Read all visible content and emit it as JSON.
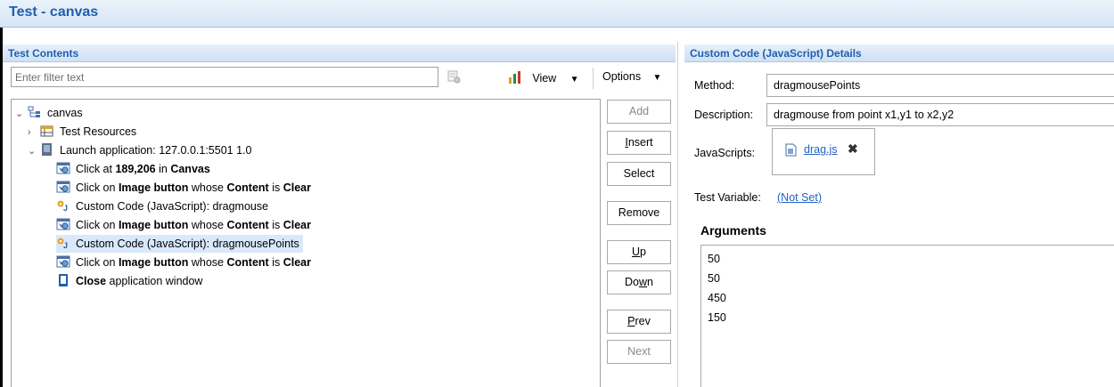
{
  "window": {
    "title": "Test - canvas"
  },
  "left_panel": {
    "header": "Test Contents",
    "filter_placeholder": "Enter filter text",
    "view_label": "View",
    "options_label": "Options",
    "tree": [
      {
        "indent": 0,
        "twisty": "open",
        "icon": "root-icon",
        "plain": "canvas",
        "bold": "",
        "rest": "",
        "selected": false
      },
      {
        "indent": 1,
        "twisty": "closed",
        "icon": "resources-icon",
        "plain": "Test Resources",
        "bold": "",
        "rest": "",
        "selected": false
      },
      {
        "indent": 1,
        "twisty": "open",
        "icon": "application-icon",
        "plain": "Launch application: 127.0.0.1:5501  1.0",
        "bold": "",
        "rest": "",
        "selected": false
      },
      {
        "indent": 2,
        "twisty": "",
        "icon": "click-icon",
        "plain": "Click at ",
        "bold": "189,206",
        "rest": " in ",
        "bold2": "Canvas",
        "selected": false
      },
      {
        "indent": 2,
        "twisty": "",
        "icon": "click-icon",
        "plain": "Click on ",
        "bold": "Image button",
        "rest": " whose ",
        "bold2": "Content",
        "rest2": " is ",
        "bold3": "Clear",
        "selected": false
      },
      {
        "indent": 2,
        "twisty": "",
        "icon": "custom-code-icon",
        "plain": "Custom Code (JavaScript): dragmouse",
        "bold": "",
        "rest": "",
        "selected": false
      },
      {
        "indent": 2,
        "twisty": "",
        "icon": "click-icon",
        "plain": "Click on ",
        "bold": "Image button",
        "rest": " whose ",
        "bold2": "Content",
        "rest2": " is ",
        "bold3": "Clear",
        "selected": false
      },
      {
        "indent": 2,
        "twisty": "",
        "icon": "custom-code-icon",
        "plain": "Custom Code (JavaScript): dragmousePoints",
        "bold": "",
        "rest": "",
        "selected": true
      },
      {
        "indent": 2,
        "twisty": "",
        "icon": "click-icon",
        "plain": "Click on ",
        "bold": "Image button",
        "rest": " whose ",
        "bold2": "Content",
        "rest2": " is ",
        "bold3": "Clear",
        "selected": false
      },
      {
        "indent": 2,
        "twisty": "",
        "icon": "close-window-icon",
        "plain": "",
        "bold": "Close",
        "rest": " application window",
        "selected": false
      }
    ],
    "buttons": [
      {
        "label": "Add",
        "mnemonic": "",
        "enabled": false
      },
      {
        "label": "Insert",
        "mnemonic": "I",
        "enabled": true
      },
      {
        "label": "Select",
        "mnemonic": "",
        "enabled": true
      },
      {
        "label": "Remove",
        "mnemonic": "",
        "enabled": true
      },
      {
        "label": "Up",
        "mnemonic": "U",
        "enabled": true
      },
      {
        "label": "Down",
        "mnemonic": "w",
        "enabled": true
      },
      {
        "label": "Prev",
        "mnemonic": "P",
        "enabled": true
      },
      {
        "label": "Next",
        "mnemonic": "",
        "enabled": false
      }
    ]
  },
  "right_panel": {
    "header": "Custom Code (JavaScript) Details",
    "method_label": "Method:",
    "method_value": "dragmousePoints",
    "description_label": "Description:",
    "description_value": "dragmouse from point x1,y1 to x2,y2",
    "javascripts_label": "JavaScripts:",
    "javascript_file": "drag.js",
    "test_variable_label": "Test Variable:",
    "test_variable_value": "(Not Set)",
    "arguments_label": "Arguments",
    "arguments": [
      "50",
      "50",
      "450",
      "150"
    ]
  },
  "colors": {
    "title": "#1f5fae",
    "selection": "#d9e8fb",
    "link": "#1f63c7"
  }
}
